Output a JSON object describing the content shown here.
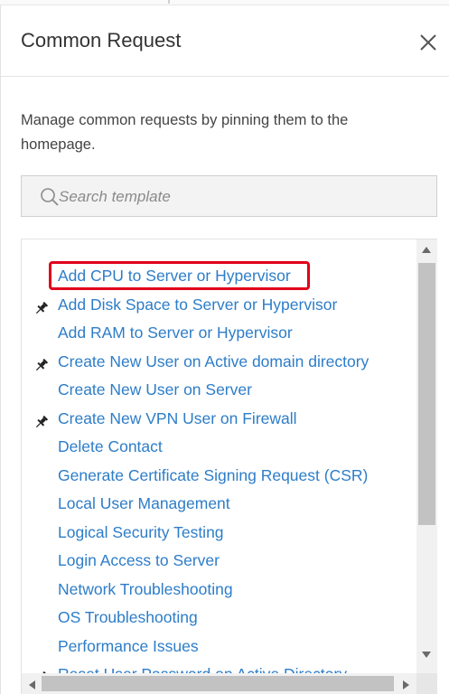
{
  "panel": {
    "title": "Common Request",
    "description": "Manage common requests by pinning them to the homepage."
  },
  "search": {
    "placeholder": "Search template",
    "value": ""
  },
  "requests": [
    {
      "label": "Add CPU to Server or Hypervisor",
      "pinned": false,
      "highlighted": true
    },
    {
      "label": "Add Disk Space to Server or Hypervisor",
      "pinned": true,
      "highlighted": false
    },
    {
      "label": "Add RAM to Server or Hypervisor",
      "pinned": false,
      "highlighted": false
    },
    {
      "label": "Create New User on Active domain directory",
      "pinned": true,
      "highlighted": false
    },
    {
      "label": "Create New User on Server",
      "pinned": false,
      "highlighted": false
    },
    {
      "label": "Create New VPN User on Firewall",
      "pinned": true,
      "highlighted": false
    },
    {
      "label": "Delete Contact",
      "pinned": false,
      "highlighted": false
    },
    {
      "label": "Generate Certificate Signing Request (CSR)",
      "pinned": false,
      "highlighted": false
    },
    {
      "label": "Local User Management",
      "pinned": false,
      "highlighted": false
    },
    {
      "label": "Logical Security Testing",
      "pinned": false,
      "highlighted": false
    },
    {
      "label": "Login Access to Server",
      "pinned": false,
      "highlighted": false
    },
    {
      "label": "Network Troubleshooting",
      "pinned": false,
      "highlighted": false
    },
    {
      "label": "OS Troubleshooting",
      "pinned": false,
      "highlighted": false
    },
    {
      "label": "Performance Issues",
      "pinned": false,
      "highlighted": false
    },
    {
      "label": "Reset User Password on Active Directory",
      "pinned": true,
      "highlighted": false
    }
  ],
  "colors": {
    "link": "#2d7dc8",
    "highlight": "#e0001b",
    "pin": "#222222"
  },
  "icons": {
    "close": "close-icon",
    "search": "search-icon",
    "pin": "pin-icon"
  }
}
